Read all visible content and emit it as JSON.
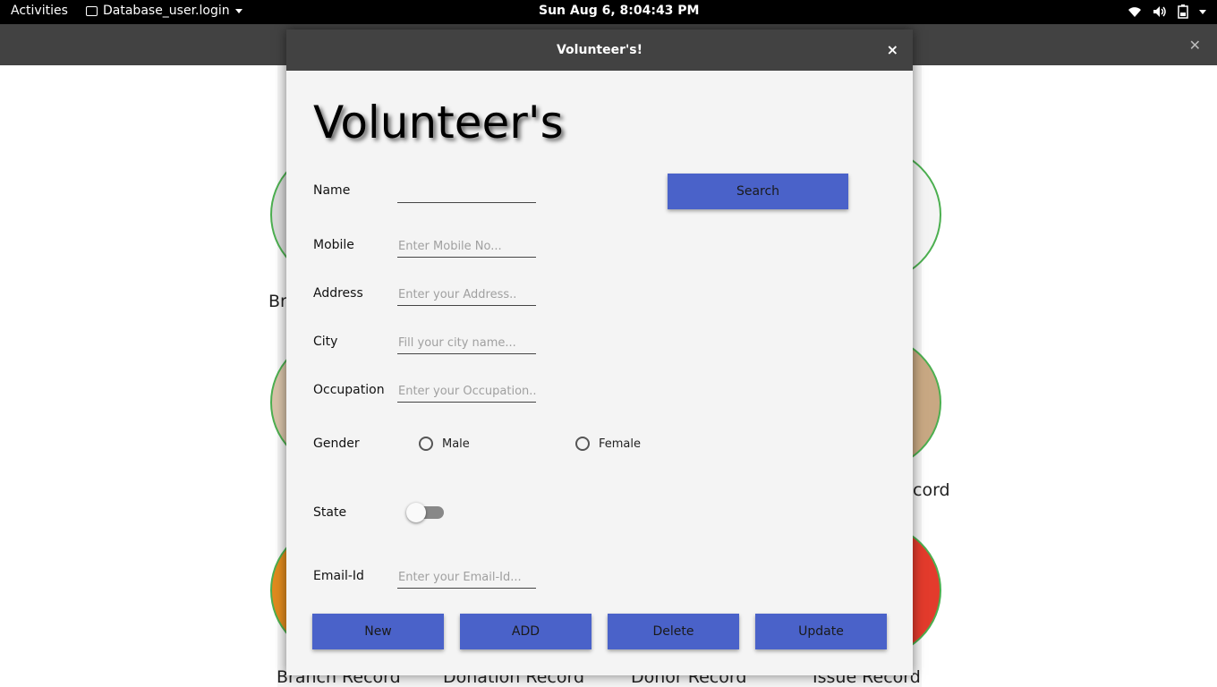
{
  "topbar": {
    "activities": "Activities",
    "app_name": "Database_user.login",
    "clock": "Sun Aug  6,  8:04:43 PM"
  },
  "background": {
    "labels": [
      "Br",
      "cord",
      "Branch Record",
      "Donation Record",
      "Donor Record",
      "Issue Record"
    ]
  },
  "dialog": {
    "title": "Volunteer's!",
    "close": "×",
    "heading": "Volunteer's"
  },
  "form": {
    "name_label": "Name",
    "name_value": "",
    "mobile_label": "Mobile",
    "mobile_placeholder": "Enter Mobile No...",
    "address_label": "Address",
    "address_placeholder": "Enter your Address..",
    "city_label": "City",
    "city_placeholder": "Fill your city name...",
    "occupation_label": "Occupation",
    "occupation_placeholder": "Enter your Occupation..",
    "gender_label": "Gender",
    "gender_options": [
      "Male",
      "Female"
    ],
    "state_label": "State",
    "email_label": "Email-Id",
    "email_placeholder": "Enter your Email-Id..."
  },
  "buttons": {
    "search": "Search",
    "new": "New",
    "add": "ADD",
    "delete": "Delete",
    "update": "Update"
  },
  "colors": {
    "accent": "#4a62c9",
    "title_bar": "#424242",
    "ring": "#4caf50"
  }
}
